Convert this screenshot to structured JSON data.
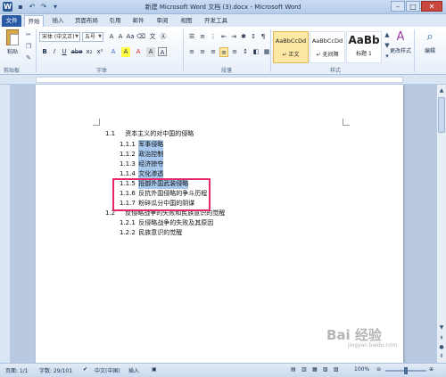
{
  "window": {
    "title": "新建 Microsoft Word 文档 (3).docx - Microsoft Word",
    "logo": "W",
    "qat": [
      "save-icon",
      "undo-icon",
      "redo-icon",
      "customize-icon"
    ],
    "buttons": {
      "minimize": "–",
      "maximize": "□",
      "close": "✕"
    }
  },
  "tabs": [
    "文件",
    "开始",
    "插入",
    "页面布局",
    "引用",
    "邮件",
    "审阅",
    "视图",
    "开发工具"
  ],
  "ribbon": {
    "clipboard": {
      "paste_label": "粘贴",
      "group": "剪贴板"
    },
    "font": {
      "name": "宋体 (中文正)",
      "size": "五号",
      "group": "字体",
      "buttons": [
        "B",
        "I",
        "U",
        "abe",
        "x₂",
        "x²",
        "A",
        "A",
        "A",
        "A"
      ]
    },
    "paragraph": {
      "group": "段落"
    },
    "styles": {
      "group": "样式",
      "items": [
        {
          "sample": "AaBbCcDd",
          "name": "↵ 正文"
        },
        {
          "sample": "AaBbCcDd",
          "name": "↵ 无间隔"
        },
        {
          "sample": "AaBb",
          "name": "标题 1"
        }
      ],
      "change_styles": "更改样式"
    },
    "editing": {
      "label": "编辑"
    }
  },
  "document": {
    "lines": [
      {
        "num": "1.1",
        "text": "资本主义的对中国的侵略",
        "selected": false
      },
      {
        "num": "1.1.1",
        "text": "军事侵略",
        "selected": true
      },
      {
        "num": "1.1.2",
        "text": "政治控制",
        "selected": true
      },
      {
        "num": "1.1.3",
        "text": "经济掠夺",
        "selected": true
      },
      {
        "num": "1.1.4",
        "text": "文化渗透",
        "selected": true
      },
      {
        "num": "1.1.5",
        "text": "抵御外国武装侵略",
        "selected": true
      },
      {
        "num": "1.1.6",
        "text": "反抗外国侵略的争斗历程",
        "selected": false
      },
      {
        "num": "1.1.7",
        "text": "粉碎瓜分中国的阴谋",
        "selected": false
      },
      {
        "num": "1.2",
        "text": "反侵略战争的失败和民族意识的觉醒",
        "selected": false
      },
      {
        "num": "1.2.1",
        "text": "反侵略战争的失败及其原因",
        "selected": false
      },
      {
        "num": "1.2.2",
        "text": "民族意识的觉醒",
        "selected": false
      }
    ]
  },
  "statusbar": {
    "page": "页面: 1/1",
    "words": "字数: 29/101",
    "language": "中文(中国)",
    "mode": "插入",
    "zoom": "100%"
  },
  "watermark": {
    "text": "Bai 经验",
    "sub": "jingyan.baidu.com"
  }
}
